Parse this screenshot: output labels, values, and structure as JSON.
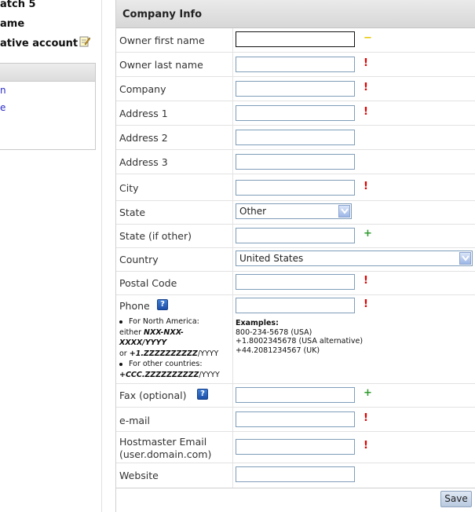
{
  "sidebar": {
    "line1": "atch 5",
    "line2": "ame",
    "line3": "ative account",
    "link1": "n",
    "link2": "e"
  },
  "panel": {
    "title": "Company Info"
  },
  "fields": {
    "owner_first_name": {
      "label": "Owner first name",
      "value": "",
      "status": "−"
    },
    "owner_last_name": {
      "label": "Owner last name",
      "value": "",
      "status": "!"
    },
    "company": {
      "label": "Company",
      "value": "",
      "status": "!"
    },
    "address1": {
      "label": "Address 1",
      "value": "",
      "status": "!"
    },
    "address2": {
      "label": "Address 2",
      "value": ""
    },
    "address3": {
      "label": "Address 3",
      "value": ""
    },
    "city": {
      "label": "City",
      "value": "",
      "status": "!"
    },
    "state": {
      "label": "State",
      "value": "Other"
    },
    "state_other": {
      "label": "State (if other)",
      "value": "",
      "status": "+"
    },
    "country": {
      "label": "Country",
      "value": "United States"
    },
    "postal_code": {
      "label": "Postal Code",
      "value": "",
      "status": "!"
    },
    "phone": {
      "label": "Phone",
      "value": "",
      "status": "!"
    },
    "fax": {
      "label": "Fax (optional)",
      "value": "",
      "status": "+"
    },
    "email": {
      "label": "e-mail",
      "value": "",
      "status": "!"
    },
    "hostmaster_email": {
      "label_line1": "Hostmaster Email",
      "label_line2": "(user.domain.com)",
      "value": "",
      "status": "!"
    },
    "website": {
      "label": "Website",
      "value": ""
    }
  },
  "phone_help": {
    "na_line1": "For North America:",
    "na_line2_prefix": "either ",
    "na_line2_fmt": "NXX-NXX-",
    "na_line3_fmt": "XXXX/YYYY",
    "na_line4_prefix": "or ",
    "na_line4_fmt": "+1.ZZZZZZZZZZ",
    "na_line4_suffix": "/YYYY",
    "other_line1": "For other countries:",
    "other_line2_fmt": "+CCC.ZZZZZZZZZZ",
    "other_line2_suffix": "/YYYY"
  },
  "phone_examples": {
    "heading": "Examples:",
    "ex1": "800-234-5678  (USA)",
    "ex2": "+1.8002345678  (USA alternative)",
    "ex3": "+44.2081234567  (UK)"
  },
  "help_icon": "?",
  "save_label": "Save",
  "colors": {
    "required": "#e00000",
    "optional": "#2d9a2d",
    "current": "#e6c600",
    "link": "#2a2ac8"
  }
}
